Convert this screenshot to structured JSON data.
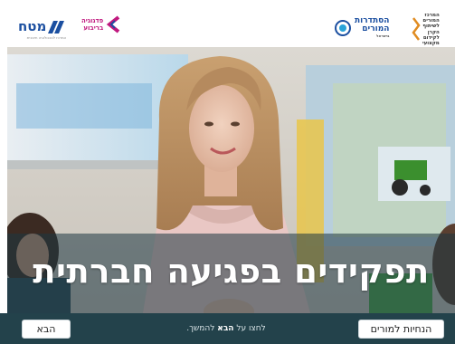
{
  "header": {
    "logos": {
      "matach": {
        "name": "מטח",
        "subtitle": "המרכז לטכנולוגיה חינוכית"
      },
      "briga": {
        "line1": "פדגוגיה",
        "line2": "בריבוע"
      },
      "histadrut": {
        "line1": "הסתדרות",
        "line2": "המורים",
        "subtitle": "בישראל"
      },
      "keren": {
        "line1": "המרכז",
        "line2": "המורים",
        "line3": "לשיתוף",
        "line4": "הקרן",
        "line5": "לקידום",
        "line6": "מקצועי"
      }
    }
  },
  "main": {
    "title": "תפקידים בפגיעה חברתית"
  },
  "footer": {
    "guide_button": "הנחיות למורים",
    "instruction_prefix": "לחצו על",
    "instruction_bold": "הבא",
    "instruction_suffix": "להמשך.",
    "next_button": "הבא"
  },
  "colors": {
    "footer_bg": "#23424b",
    "matach_blue": "#1b4fa0",
    "briga_magenta": "#c0187e"
  }
}
